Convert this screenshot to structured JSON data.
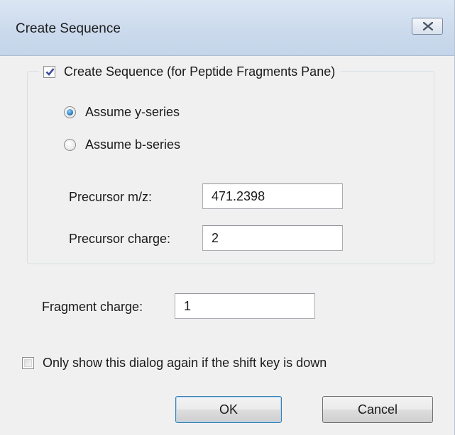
{
  "dialog": {
    "title": "Create Sequence",
    "close_icon": "close-icon"
  },
  "group": {
    "checkbox_label": "Create Sequence (for Peptide Fragments Pane)",
    "checked": true,
    "radios": [
      {
        "label": "Assume y-series",
        "selected": true
      },
      {
        "label": "Assume b-series",
        "selected": false
      }
    ],
    "precursor_mz_label": "Precursor m/z:",
    "precursor_mz_value": "471.2398",
    "precursor_charge_label": "Precursor charge:",
    "precursor_charge_value": "2"
  },
  "fragment_charge_label": "Fragment charge:",
  "fragment_charge_value": "1",
  "shift_checkbox_label": "Only show this dialog again if the shift key is down",
  "shift_checkbox_checked": false,
  "buttons": {
    "ok_label": "OK",
    "cancel_label": "Cancel"
  },
  "colors": {
    "titlebar": "#cad9ec",
    "checkmark": "#3c4ea0",
    "radio_dot": "#1f6fb4",
    "default_button_border": "#3c7fb1"
  }
}
